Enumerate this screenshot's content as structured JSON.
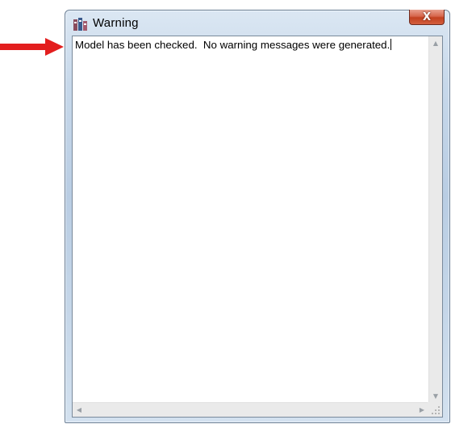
{
  "window": {
    "title": "Warning",
    "app_icon": "app-icon",
    "close_label": "X"
  },
  "text_area": {
    "content": "Model has been checked.  No warning messages were generated."
  },
  "scrollbars": {
    "up_glyph": "▲",
    "down_glyph": "▼",
    "left_glyph": "◀",
    "right_glyph": "▶"
  },
  "annotation": {
    "arrow_color": "#e31e1e"
  }
}
